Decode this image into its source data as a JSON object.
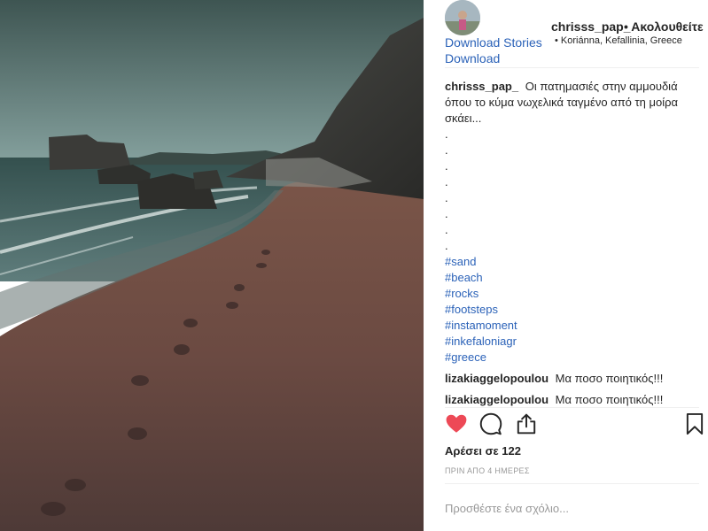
{
  "post": {
    "image_alt": "beach-with-footprints-and-rocks"
  },
  "header": {
    "download_stories": "Download Stories",
    "download": "Download",
    "username": "chrisss_pap_",
    "follow_label": "• Ακολουθείτε",
    "location": "• Koriánna, Kefallinia, Greece"
  },
  "caption": {
    "username": "chrisss_pap_",
    "text": "Οι πατημασιές στην αμμουδιά όπου το κύμα νωχελικά ταγμένο από τη μοίρα σκάει...",
    "dots": [
      ".",
      ".",
      ".",
      ".",
      ".",
      ".",
      ".",
      "."
    ],
    "hashtags": [
      "#sand",
      "#beach",
      "#rocks",
      "#footsteps",
      "#instamoment",
      "#inkefaloniagr",
      "#greece"
    ]
  },
  "comments": [
    {
      "username": "lizakiaggelopoulou",
      "text": "Μα ποσο ποιητικός!!!"
    },
    {
      "username": "lizakiaggelopoulou",
      "text": "Μα ποσο ποιητικός!!!"
    }
  ],
  "actions": {
    "like_icon": "heart-filled-icon",
    "comment_icon": "speech-bubble-icon",
    "share_icon": "share-upload-icon",
    "save_icon": "bookmark-icon",
    "like_color": "#ed4956"
  },
  "likes_text": "Αρέσει σε 122",
  "time_ago": "ΠΡΙΝ ΑΠΟ 4 ΗΜΕΡΕΣ",
  "add_comment": {
    "placeholder": "Προσθέστε ένα σχόλιο..."
  }
}
